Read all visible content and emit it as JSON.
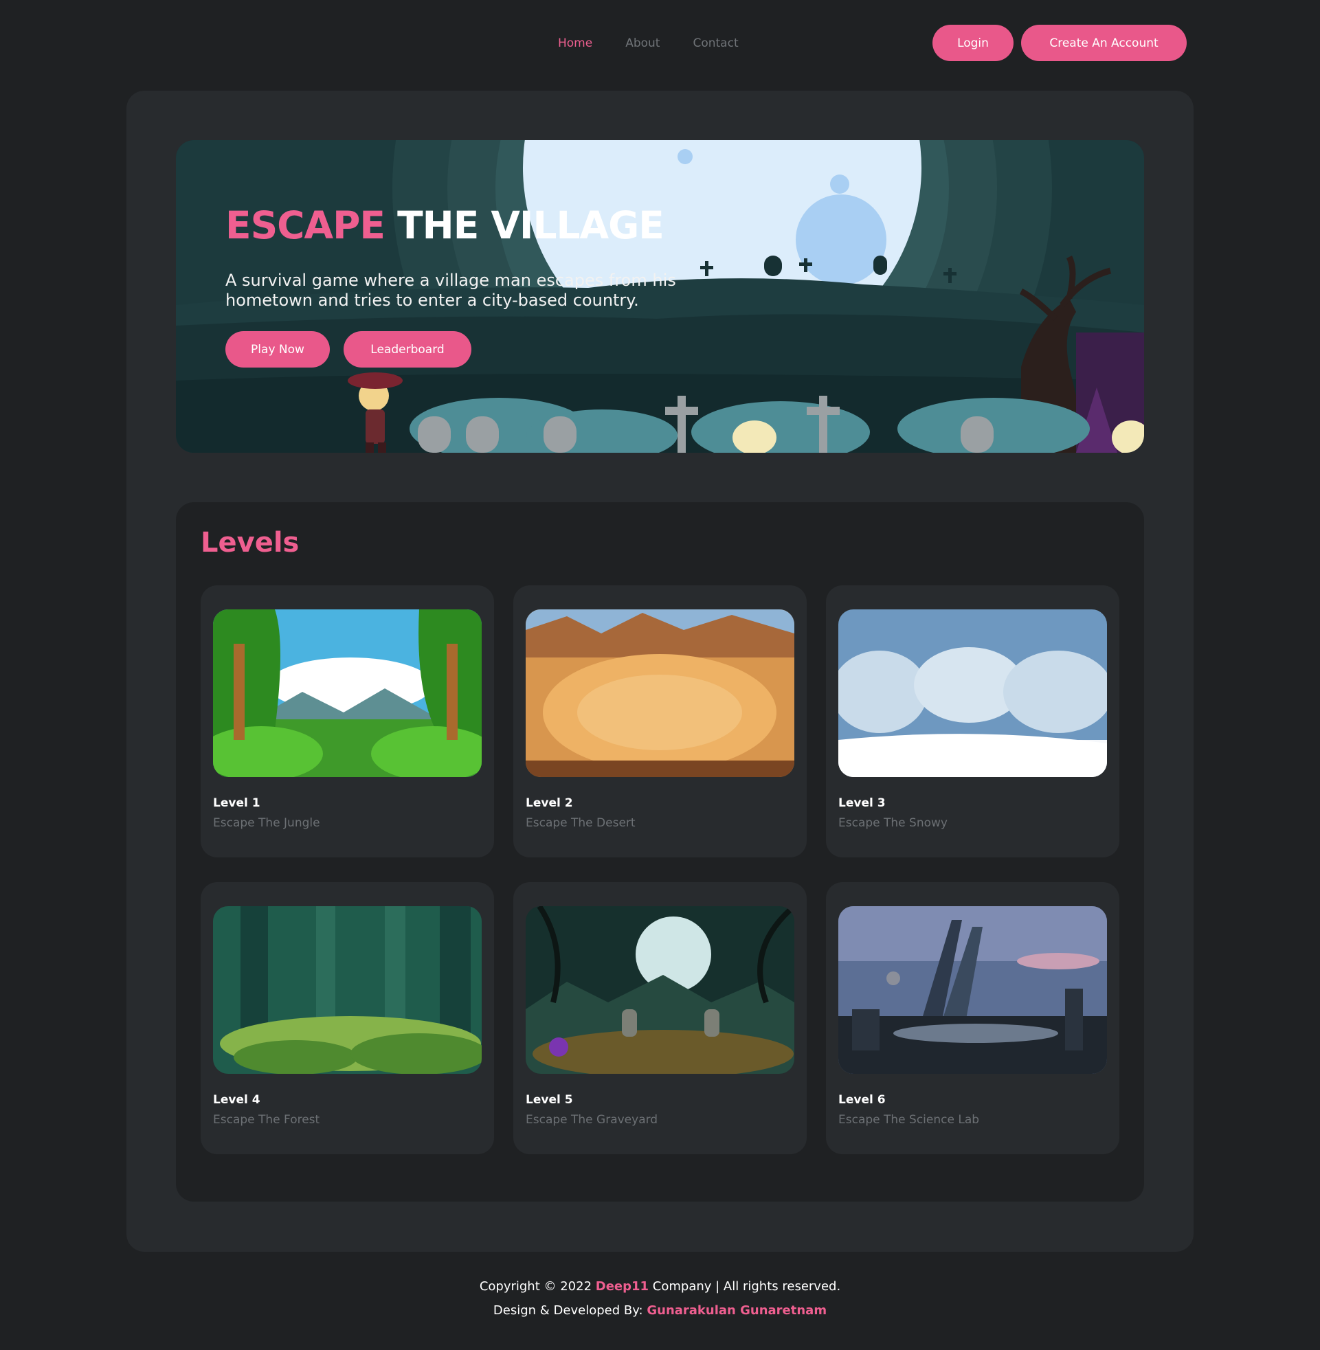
{
  "nav": {
    "links": [
      "Home",
      "About",
      "Contact"
    ],
    "login_label": "Login",
    "create_label": "Create An Account"
  },
  "hero": {
    "title_highlight": "ESCAPE",
    "title_rest": "THE VILLAGE",
    "description": "A survival game where a village man escapes from his hometown and tries to enter a city-based country.",
    "play_label": "Play Now",
    "leaderboard_label": "Leaderboard"
  },
  "levels": {
    "title": "Levels",
    "cards": [
      {
        "level": "Level 1",
        "subtitle": "Escape The Jungle"
      },
      {
        "level": "Level 2",
        "subtitle": "Escape The Desert"
      },
      {
        "level": "Level 3",
        "subtitle": "Escape The Snowy"
      },
      {
        "level": "Level 4",
        "subtitle": "Escape The Forest"
      },
      {
        "level": "Level 5",
        "subtitle": "Escape The Graveyard"
      },
      {
        "level": "Level 6",
        "subtitle": "Escape The Science Lab"
      }
    ]
  },
  "footer": {
    "copyright_prefix": "Copyright © 2022",
    "company": "Deep11",
    "copyright_suffix": "Company | All rights reserved.",
    "dev_prefix": "Design & Developed By:",
    "developer": "Gunarakulan Gunaretnam"
  },
  "colors": {
    "accent": "#e9588a",
    "background": "#1f2123",
    "panel": "#282b2e"
  }
}
